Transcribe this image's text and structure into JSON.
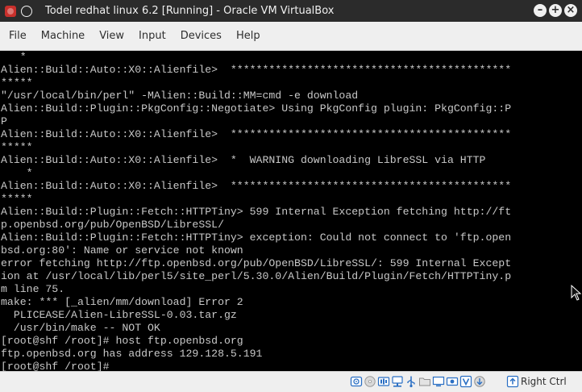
{
  "window": {
    "title": "Todel redhat linux 6.2 [Running] - Oracle VM VirtualBox"
  },
  "menu": [
    "File",
    "Machine",
    "View",
    "Input",
    "Devices",
    "Help"
  ],
  "console": {
    "text": "   *\nAlien::Build::Auto::X0::Alienfile>  ********************************************\n*****\n\"/usr/local/bin/perl\" -MAlien::Build::MM=cmd -e download\nAlien::Build::Plugin::PkgConfig::Negotiate> Using PkgConfig plugin: PkgConfig::P\nP\nAlien::Build::Auto::X0::Alienfile>  ********************************************\n*****\nAlien::Build::Auto::X0::Alienfile>  *  WARNING downloading LibreSSL via HTTP\n    *\nAlien::Build::Auto::X0::Alienfile>  ********************************************\n*****\nAlien::Build::Plugin::Fetch::HTTPTiny> 599 Internal Exception fetching http://ft\np.openbsd.org/pub/OpenBSD/LibreSSL/\nAlien::Build::Plugin::Fetch::HTTPTiny> exception: Could not connect to 'ftp.open\nbsd.org:80': Name or service not known\nerror fetching http://ftp.openbsd.org/pub/OpenBSD/LibreSSL/: 599 Internal Except\nion at /usr/local/lib/perl5/site_perl/5.30.0/Alien/Build/Plugin/Fetch/HTTPTiny.p\nm line 75.\nmake: *** [_alien/mm/download] Error 2\n  PLICEASE/Alien-LibreSSL-0.03.tar.gz\n  /usr/bin/make -- NOT OK\n[root@shf /root]# host ftp.openbsd.org\nftp.openbsd.org has address 129.128.5.191\n[root@shf /root]#"
  },
  "status_bar": {
    "host_key": "Right Ctrl"
  },
  "colors": {
    "titlebar_bg": "#2b2b2b",
    "menubar_bg": "#efefef",
    "console_bg": "#000000",
    "console_fg": "#c8c8c8",
    "status_icon_blue": "#2a6fc4"
  }
}
